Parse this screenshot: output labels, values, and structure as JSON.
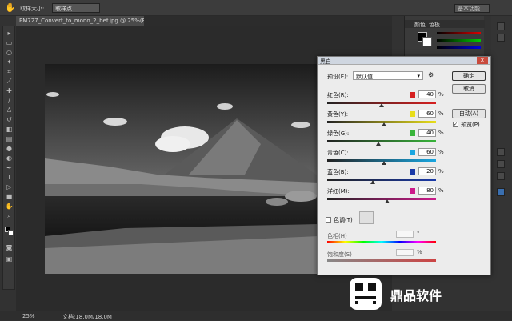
{
  "options_bar": {
    "sample_size_label": "取样大小:",
    "sample_value": "取样点",
    "workspace_label": "基本功能"
  },
  "document_tab": {
    "title": "PM727_Convert_to_mono_2_bef.jpg @ 25%(RGB/8)",
    "close": "×"
  },
  "status_bar": {
    "zoom": "25%",
    "doc_info": "文档:18.0M/18.0M"
  },
  "panels": {
    "tabs": [
      "颜色",
      "色板"
    ]
  },
  "dialog": {
    "title": "黑白",
    "close": "x",
    "preset_label": "预设(E):",
    "preset_value": "默认值",
    "buttons": {
      "ok": "确定",
      "cancel": "取消",
      "auto": "自动(A)",
      "preview": "预览(P)"
    },
    "channels": [
      {
        "label": "红色(R):",
        "value": "40",
        "unit": "%",
        "color": "#d62020",
        "pct": 0.5
      },
      {
        "label": "黄色(Y):",
        "value": "60",
        "unit": "%",
        "color": "#e8dd1a",
        "pct": 0.52
      },
      {
        "label": "绿色(G):",
        "value": "40",
        "unit": "%",
        "color": "#38b43a",
        "pct": 0.47
      },
      {
        "label": "青色(C):",
        "value": "60",
        "unit": "%",
        "color": "#1aa6e0",
        "pct": 0.52
      },
      {
        "label": "蓝色(B):",
        "value": "20",
        "unit": "%",
        "color": "#1a3aa8",
        "pct": 0.42
      },
      {
        "label": "洋红(M):",
        "value": "80",
        "unit": "%",
        "color": "#cc1a8a",
        "pct": 0.55
      }
    ],
    "tint_label": "色调(T)",
    "hue_label": "色相(H)",
    "hue_unit": "°",
    "saturation_label": "饱和度(S)",
    "saturation_unit": "%"
  },
  "watermark": {
    "text": "鼎品软件"
  },
  "colors": {
    "accent_red": "#c94a3c",
    "dialog_bg": "#ececec",
    "app_bg": "#323232"
  }
}
